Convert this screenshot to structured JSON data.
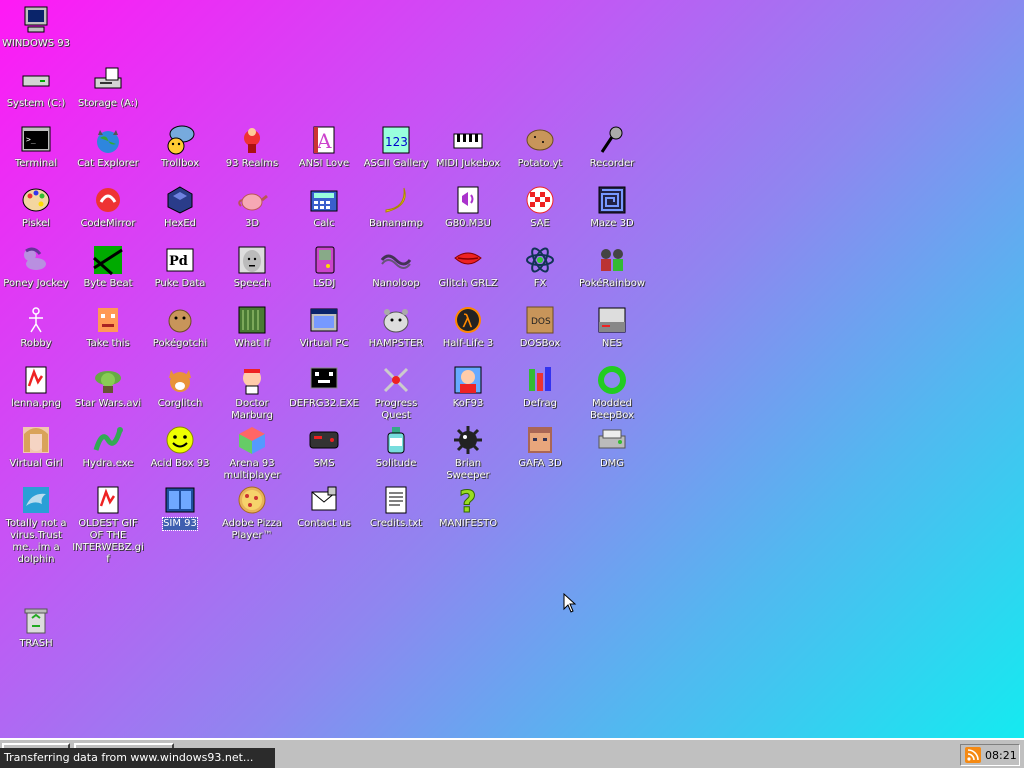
{
  "desktop": {
    "icons": [
      {
        "id": "windows93",
        "label": "WINDOWS 93",
        "icon": "computer-icon",
        "col": 0,
        "row": 0
      },
      {
        "id": "system-c",
        "label": "System (C:)",
        "icon": "drive-icon",
        "col": 0,
        "row": 1
      },
      {
        "id": "storage-a",
        "label": "Storage (A:)",
        "icon": "floppy-drive-icon",
        "col": 1,
        "row": 1
      },
      {
        "id": "terminal",
        "label": "Terminal",
        "icon": "terminal-icon",
        "col": 0,
        "row": 2
      },
      {
        "id": "cat-explorer",
        "label": "Cat Explorer",
        "icon": "globe-cat-icon",
        "col": 1,
        "row": 2
      },
      {
        "id": "trollbox",
        "label": "Trollbox",
        "icon": "chat-icon",
        "col": 2,
        "row": 2
      },
      {
        "id": "93-realms",
        "label": "93 Realms",
        "icon": "realms-icon",
        "col": 3,
        "row": 2
      },
      {
        "id": "ansi-love",
        "label": "ANSI Love",
        "icon": "ansi-icon",
        "col": 4,
        "row": 2
      },
      {
        "id": "ascii-gallery",
        "label": "ASCII Gallery",
        "icon": "ascii-icon",
        "col": 5,
        "row": 2
      },
      {
        "id": "midi-jukebox",
        "label": "MIDI Jukebox",
        "icon": "piano-icon",
        "col": 6,
        "row": 2
      },
      {
        "id": "potato",
        "label": "Potato.yt",
        "icon": "potato-icon",
        "col": 7,
        "row": 2
      },
      {
        "id": "recorder",
        "label": "Recorder",
        "icon": "microphone-icon",
        "col": 8,
        "row": 2
      },
      {
        "id": "piskel",
        "label": "Piskel",
        "icon": "palette-icon",
        "col": 0,
        "row": 3
      },
      {
        "id": "codemirror",
        "label": "CodeMirror",
        "icon": "codemirror-icon",
        "col": 1,
        "row": 3
      },
      {
        "id": "hexed",
        "label": "HexEd",
        "icon": "hexagon-icon",
        "col": 2,
        "row": 3
      },
      {
        "id": "3d",
        "label": "3D",
        "icon": "teapot-icon",
        "col": 3,
        "row": 3
      },
      {
        "id": "calc",
        "label": "Calc",
        "icon": "calculator-icon",
        "col": 4,
        "row": 3
      },
      {
        "id": "bananamp",
        "label": "Bananamp",
        "icon": "banana-icon",
        "col": 5,
        "row": 3
      },
      {
        "id": "g80m3u",
        "label": "G80.M3U",
        "icon": "playlist-icon",
        "col": 6,
        "row": 3
      },
      {
        "id": "sae",
        "label": "SAE",
        "icon": "checkered-ball-icon",
        "col": 7,
        "row": 3
      },
      {
        "id": "maze3d",
        "label": "Maze 3D",
        "icon": "maze-icon",
        "col": 8,
        "row": 3
      },
      {
        "id": "poney-jockey",
        "label": "Poney Jockey",
        "icon": "pony-icon",
        "col": 0,
        "row": 4
      },
      {
        "id": "byte-beat",
        "label": "Byte Beat",
        "icon": "bytebeat-icon",
        "col": 1,
        "row": 4
      },
      {
        "id": "puke-data",
        "label": "Puke Data",
        "icon": "pd-icon",
        "col": 2,
        "row": 4
      },
      {
        "id": "speech",
        "label": "Speech",
        "icon": "face-icon",
        "col": 3,
        "row": 4
      },
      {
        "id": "lsdj",
        "label": "LSDJ",
        "icon": "gameboy-icon",
        "col": 4,
        "row": 4
      },
      {
        "id": "nanoloop",
        "label": "Nanoloop",
        "icon": "wave-icon",
        "col": 5,
        "row": 4
      },
      {
        "id": "glitch-grlz",
        "label": "Glitch GRLZ",
        "icon": "lips-icon",
        "col": 6,
        "row": 4
      },
      {
        "id": "fx",
        "label": "FX",
        "icon": "atom-icon",
        "col": 7,
        "row": 4
      },
      {
        "id": "pokerainbow",
        "label": "PokéRainbow",
        "icon": "pokerainbow-icon",
        "col": 8,
        "row": 4
      },
      {
        "id": "robby",
        "label": "Robby",
        "icon": "stickman-icon",
        "col": 0,
        "row": 5
      },
      {
        "id": "take-this",
        "label": "Take this",
        "icon": "pixel-face-icon",
        "col": 1,
        "row": 5
      },
      {
        "id": "pokegotchi",
        "label": "Pokégotchi",
        "icon": "pokegotchi-icon",
        "col": 2,
        "row": 5
      },
      {
        "id": "what-if",
        "label": "What If",
        "icon": "whatif-icon",
        "col": 3,
        "row": 5
      },
      {
        "id": "virtual-pc",
        "label": "Virtual PC",
        "icon": "window-icon",
        "col": 4,
        "row": 5
      },
      {
        "id": "hampster",
        "label": "HAMPSTER",
        "icon": "hamster-icon",
        "col": 5,
        "row": 5
      },
      {
        "id": "half-life-3",
        "label": "Half-Life 3",
        "icon": "lambda-icon",
        "col": 6,
        "row": 5
      },
      {
        "id": "dosbox",
        "label": "DOSBox",
        "icon": "dosbox-icon",
        "col": 7,
        "row": 5
      },
      {
        "id": "nes",
        "label": "NES",
        "icon": "nes-icon",
        "col": 8,
        "row": 5
      },
      {
        "id": "lenna",
        "label": "lenna.png",
        "icon": "image-file-icon",
        "col": 0,
        "row": 6
      },
      {
        "id": "star-wars",
        "label": "Star Wars.avi",
        "icon": "yoda-icon",
        "col": 1,
        "row": 6
      },
      {
        "id": "corglitch",
        "label": "Corglitch",
        "icon": "corgi-icon",
        "col": 2,
        "row": 6
      },
      {
        "id": "doctor-marburg",
        "label": "Doctor Marburg",
        "icon": "doctor-icon",
        "col": 3,
        "row": 6
      },
      {
        "id": "defrag32",
        "label": "DEFRG32.EXE",
        "icon": "defrag-face-icon",
        "col": 4,
        "row": 6
      },
      {
        "id": "progress-quest",
        "label": "Progress Quest",
        "icon": "swords-icon",
        "col": 5,
        "row": 6
      },
      {
        "id": "kof93",
        "label": "KoF93",
        "icon": "fighter-icon",
        "col": 6,
        "row": 6
      },
      {
        "id": "defrag",
        "label": "Defrag",
        "icon": "defrag-icon",
        "col": 7,
        "row": 6
      },
      {
        "id": "modded-beepbox",
        "label": "Modded BeepBox",
        "icon": "ring-icon",
        "col": 8,
        "row": 6
      },
      {
        "id": "virtual-girl",
        "label": "Virtual Girl",
        "icon": "portrait-icon",
        "col": 0,
        "row": 7
      },
      {
        "id": "hydra",
        "label": "Hydra.exe",
        "icon": "hydra-icon",
        "col": 1,
        "row": 7
      },
      {
        "id": "acid-box-93",
        "label": "Acid Box 93",
        "icon": "smiley-icon",
        "col": 2,
        "row": 7
      },
      {
        "id": "arena-93",
        "label": "Arena 93 multiplayer",
        "icon": "cube-icon",
        "col": 3,
        "row": 7
      },
      {
        "id": "sms",
        "label": "SMS",
        "icon": "console-icon",
        "col": 4,
        "row": 7
      },
      {
        "id": "solitude",
        "label": "Solitude",
        "icon": "bottle-icon",
        "col": 5,
        "row": 7
      },
      {
        "id": "brian-sweeper",
        "label": "Brian Sweeper",
        "icon": "mine-icon",
        "col": 6,
        "row": 7
      },
      {
        "id": "gafa-3d",
        "label": "GAFA 3D",
        "icon": "doomguy-icon",
        "col": 7,
        "row": 7
      },
      {
        "id": "dmg",
        "label": "DMG",
        "icon": "disk-image-icon",
        "col": 8,
        "row": 7
      },
      {
        "id": "dolphin",
        "label": "Totally not a virus.Trust me...im a dolphin",
        "icon": "dolphin-icon",
        "col": 0,
        "row": 8
      },
      {
        "id": "oldest-gif",
        "label": "OLDEST GIF OF THE INTERWEBZ.gif",
        "icon": "image-file-icon",
        "col": 1,
        "row": 8
      },
      {
        "id": "sim93",
        "label": "SIM 93",
        "icon": "sim-book-icon",
        "col": 2,
        "row": 8,
        "selected": true
      },
      {
        "id": "pizza-player",
        "label": "Adobe Pizza Player™",
        "icon": "pizza-icon",
        "col": 3,
        "row": 8
      },
      {
        "id": "contact-us",
        "label": "Contact us",
        "icon": "letter-icon",
        "col": 4,
        "row": 8
      },
      {
        "id": "credits",
        "label": "Credits.txt",
        "icon": "text-file-icon",
        "col": 5,
        "row": 8
      },
      {
        "id": "manifesto",
        "label": "MANIFESTO",
        "icon": "question-mark-icon",
        "col": 6,
        "row": 8
      },
      {
        "id": "trash",
        "label": "TRASH",
        "icon": "recycle-bin-icon",
        "col": 0,
        "row": 10
      }
    ]
  },
  "status_bar": {
    "text": "Transferring data from www.windows93.net..."
  },
  "taskbar": {
    "clock": "08:21",
    "tray_icon": "rss-icon"
  }
}
